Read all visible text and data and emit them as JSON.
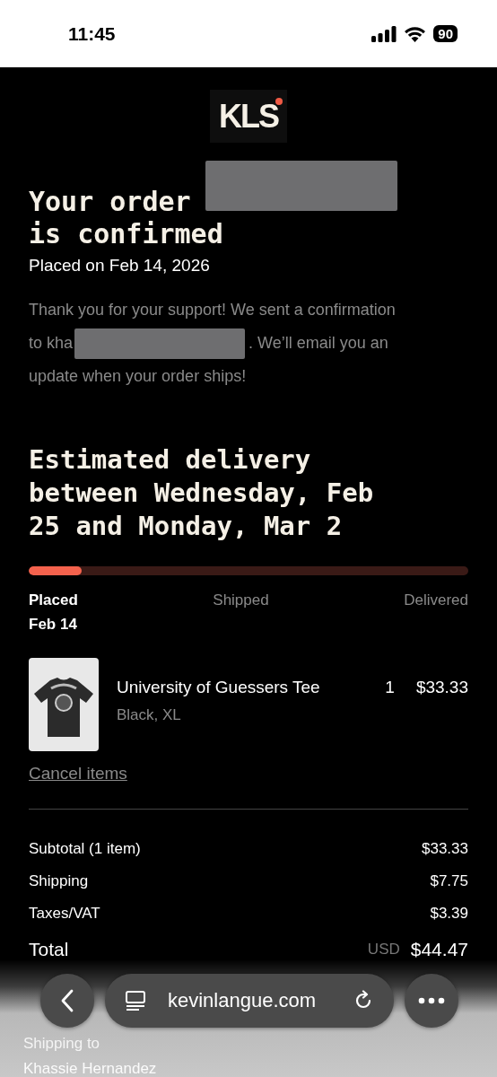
{
  "status_bar": {
    "time": "11:45",
    "battery": "90"
  },
  "logo": {
    "text": "KLS"
  },
  "heading": {
    "line_1": "Your order",
    "line_2": "is confirmed",
    "redacted": true
  },
  "placed_on": "Placed on Feb 14, 2026",
  "message": {
    "line_1": "Thank you for your support! We sent a confirmation",
    "line_2_start": "to kha",
    "line_2_end": ". We’ll email you an",
    "line_3": "update when your order ships!",
    "redacted": true
  },
  "delivery_estimate": "Estimated delivery between Wednesday, Feb 25 and Monday, Mar 2",
  "progress": {
    "level": 0.12,
    "steps": [
      {
        "label": "Placed",
        "date": "Feb 14",
        "reached": true
      },
      {
        "label": "Shipped",
        "reached": false
      },
      {
        "label": "Delivered",
        "reached": false
      }
    ]
  },
  "items": [
    {
      "name": "University of Guessers Tee",
      "variant": "Black, XL",
      "quantity": "1",
      "price": "$33.33"
    }
  ],
  "cancel_link": "Cancel items",
  "totals": [
    {
      "label": "Subtotal (1 item)",
      "value": "$33.33",
      "kind": "line"
    },
    {
      "label": "Shipping",
      "value": "$7.75",
      "kind": "line"
    },
    {
      "label": "Taxes/VAT",
      "value": "$3.39",
      "kind": "line"
    },
    {
      "label": "Total",
      "currency": "USD",
      "value": "$44.47",
      "kind": "total"
    }
  ],
  "shipping": {
    "heading": "Shipping to",
    "name": "Khassie Hernandez"
  },
  "browser": {
    "url": "kevinlangue.com"
  }
}
